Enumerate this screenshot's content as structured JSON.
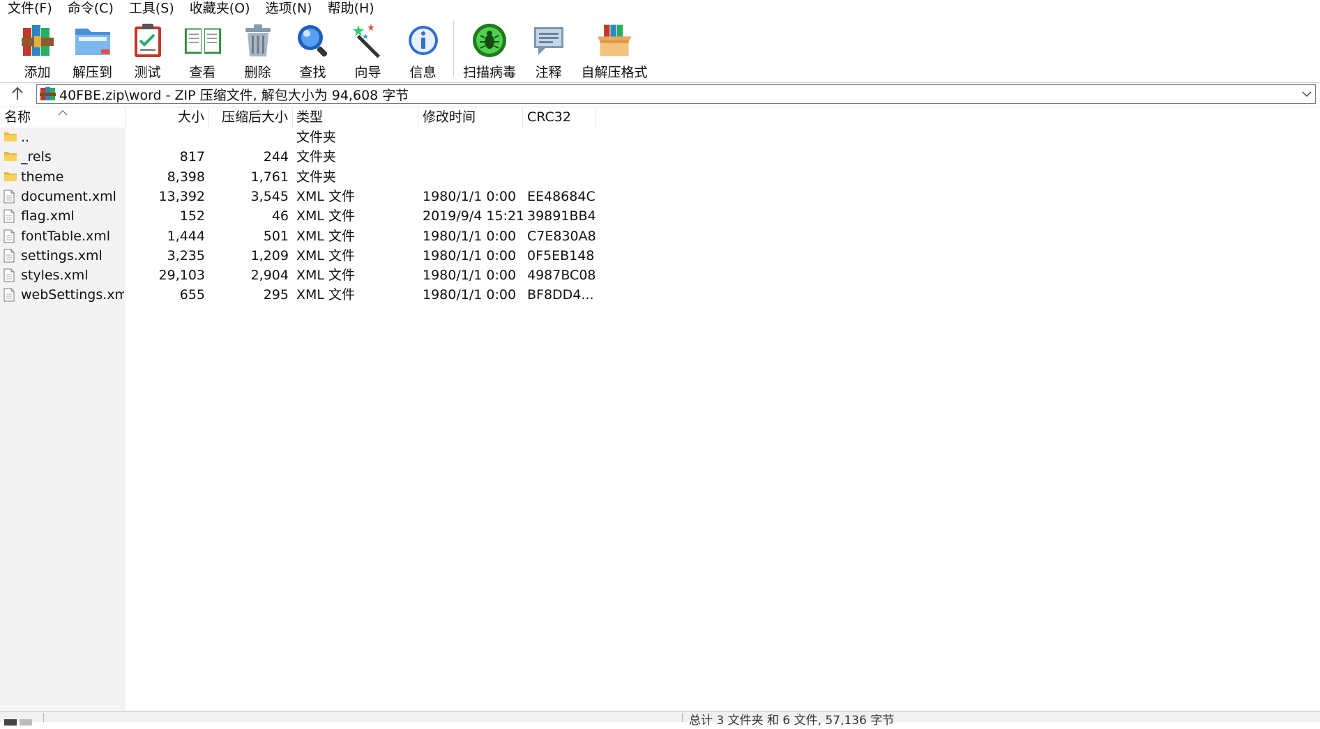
{
  "menu": [
    "文件(F)",
    "命令(C)",
    "工具(S)",
    "收藏夹(O)",
    "选项(N)",
    "帮助(H)"
  ],
  "toolbar": {
    "add": "添加",
    "extract": "解压到",
    "test": "测试",
    "view": "查看",
    "delete": "删除",
    "find": "查找",
    "wizard": "向导",
    "info": "信息",
    "scan": "扫描病毒",
    "comment": "注释",
    "sfx": "自解压格式"
  },
  "address": {
    "path": "40FBE.zip\\word - ZIP 压缩文件, 解包大小为 94,608 字节"
  },
  "columns": {
    "name": "名称",
    "size": "大小",
    "packed": "压缩后大小",
    "type": "类型",
    "modified": "修改时间",
    "crc": "CRC32"
  },
  "files": [
    {
      "name": "..",
      "size": "",
      "packed": "",
      "type": "文件夹",
      "modified": "",
      "crc": "",
      "icon": "folder-icon"
    },
    {
      "name": "_rels",
      "size": "817",
      "packed": "244",
      "type": "文件夹",
      "modified": "",
      "crc": "",
      "icon": "folder-icon"
    },
    {
      "name": "theme",
      "size": "8,398",
      "packed": "1,761",
      "type": "文件夹",
      "modified": "",
      "crc": "",
      "icon": "folder-icon"
    },
    {
      "name": "document.xml",
      "size": "13,392",
      "packed": "3,545",
      "type": "XML 文件",
      "modified": "1980/1/1 0:00",
      "crc": "EE48684C",
      "icon": "file-icon"
    },
    {
      "name": "flag.xml",
      "size": "152",
      "packed": "46",
      "type": "XML 文件",
      "modified": "2019/9/4 15:21",
      "crc": "39891BB4",
      "icon": "file-icon"
    },
    {
      "name": "fontTable.xml",
      "size": "1,444",
      "packed": "501",
      "type": "XML 文件",
      "modified": "1980/1/1 0:00",
      "crc": "C7E830A8",
      "icon": "file-icon"
    },
    {
      "name": "settings.xml",
      "size": "3,235",
      "packed": "1,209",
      "type": "XML 文件",
      "modified": "1980/1/1 0:00",
      "crc": "0F5EB148",
      "icon": "file-icon"
    },
    {
      "name": "styles.xml",
      "size": "29,103",
      "packed": "2,904",
      "type": "XML 文件",
      "modified": "1980/1/1 0:00",
      "crc": "4987BC08",
      "icon": "file-icon"
    },
    {
      "name": "webSettings.xml",
      "size": "655",
      "packed": "295",
      "type": "XML 文件",
      "modified": "1980/1/1 0:00",
      "crc": "BF8DD4...",
      "icon": "file-icon"
    }
  ],
  "status": {
    "text": "总计 3 文件夹 和 6 文件, 57,136 字节"
  }
}
